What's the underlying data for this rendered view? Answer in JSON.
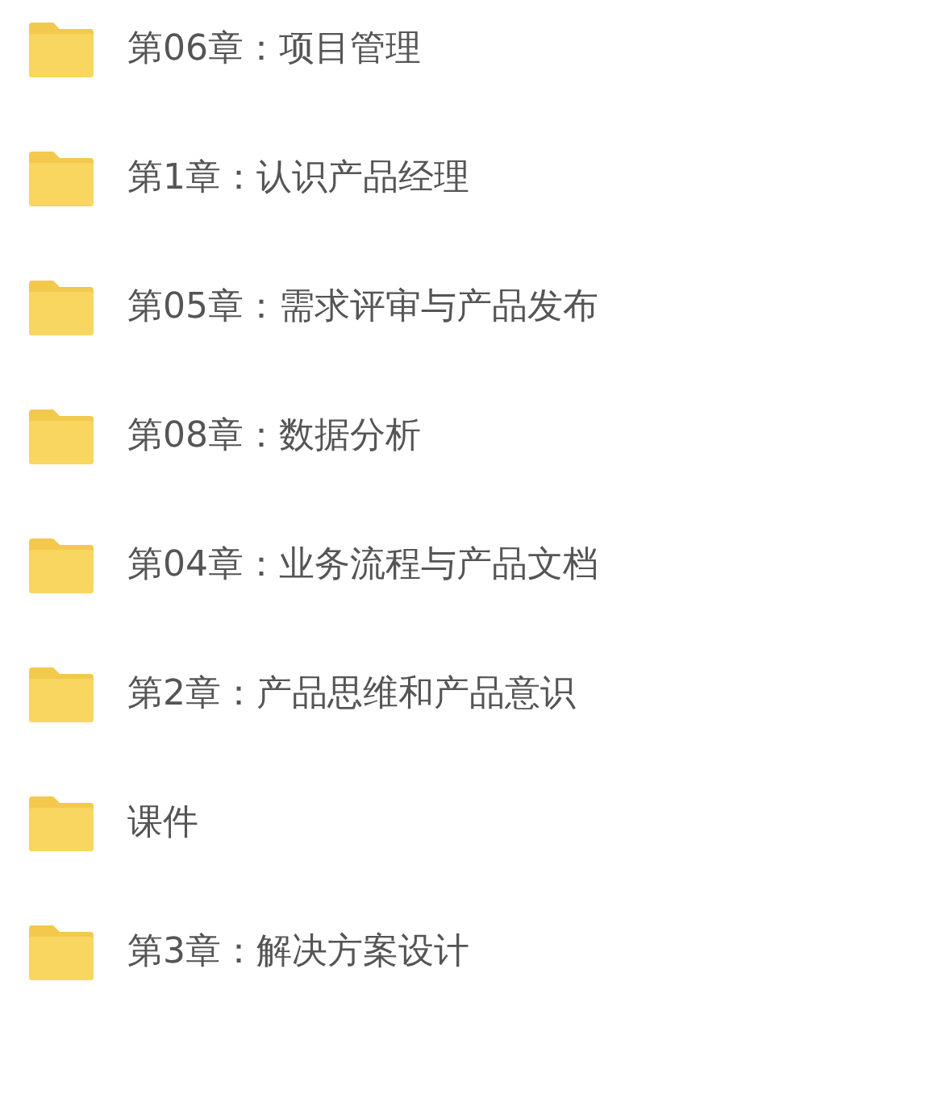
{
  "folders": [
    {
      "name": "第06章：项目管理"
    },
    {
      "name": "第1章：认识产品经理"
    },
    {
      "name": "第05章：需求评审与产品发布"
    },
    {
      "name": "第08章：数据分析"
    },
    {
      "name": "第04章：业务流程与产品文档"
    },
    {
      "name": "第2章：产品思维和产品意识"
    },
    {
      "name": "课件"
    },
    {
      "name": "第3章：解决方案设计"
    }
  ]
}
